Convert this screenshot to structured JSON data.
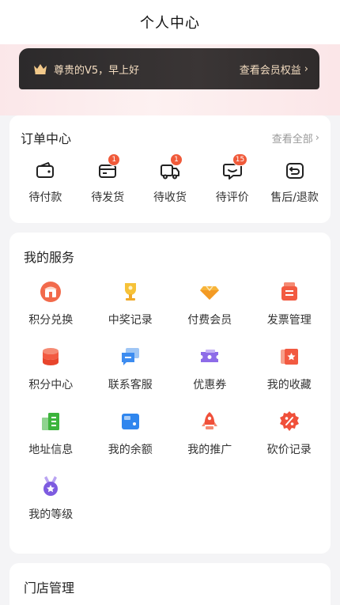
{
  "nav": {
    "title": "个人中心"
  },
  "vip": {
    "text": "尊贵的V5，早上好",
    "link": "查看会员权益"
  },
  "orders": {
    "title": "订单中心",
    "more": "查看全部",
    "items": [
      {
        "label": "待付款",
        "icon": "wallet-icon"
      },
      {
        "label": "待发货",
        "icon": "card-icon",
        "badge": "1"
      },
      {
        "label": "待收货",
        "icon": "truck-icon",
        "badge": "1"
      },
      {
        "label": "待评价",
        "icon": "comment-icon",
        "badge": "15"
      },
      {
        "label": "售后/退款",
        "icon": "return-icon"
      }
    ]
  },
  "services": {
    "title": "我的服务",
    "items": [
      {
        "label": "积分兑换",
        "icon": "store-icon"
      },
      {
        "label": "中奖记录",
        "icon": "trophy-icon"
      },
      {
        "label": "付费会员",
        "icon": "diamond-icon"
      },
      {
        "label": "发票管理",
        "icon": "invoice-icon"
      },
      {
        "label": "积分中心",
        "icon": "coins-icon"
      },
      {
        "label": "联系客服",
        "icon": "chat-icon"
      },
      {
        "label": "优惠券",
        "icon": "ticket-icon"
      },
      {
        "label": "我的收藏",
        "icon": "star-card-icon"
      },
      {
        "label": "地址信息",
        "icon": "building-icon"
      },
      {
        "label": "我的余额",
        "icon": "wallet-card-icon"
      },
      {
        "label": "我的推广",
        "icon": "rocket-icon"
      },
      {
        "label": "砍价记录",
        "icon": "discount-icon"
      },
      {
        "label": "我的等级",
        "icon": "medal-icon"
      }
    ]
  },
  "store": {
    "title": "门店管理"
  },
  "colors": {
    "accent": "#f05a3a",
    "vip_text": "#f3dcc0",
    "vip_bg": "#2c2a2b"
  }
}
